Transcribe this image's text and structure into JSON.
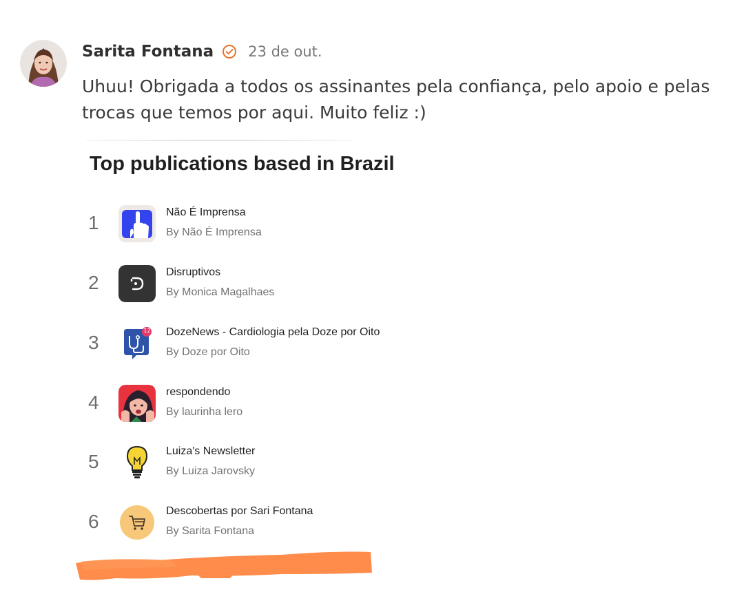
{
  "post": {
    "author": "Sarita Fontana",
    "date": "23 de out.",
    "text": "Uhuu! Obrigada a todos os assinantes pela confiança, pelo apoio e pelas trocas que temos por aqui. Muito feliz :)"
  },
  "card": {
    "title": "Top publications based in Brazil",
    "items": [
      {
        "rank": "1",
        "name": "Não É Imprensa",
        "author": "By Não É Imprensa",
        "logo": "pointing-hand-icon"
      },
      {
        "rank": "2",
        "name": "Disruptivos",
        "author": "By Monica Magalhaes",
        "logo": "d-letter-icon"
      },
      {
        "rank": "3",
        "name": "DozeNews - Cardiologia pela Doze por Oito",
        "author": "By Doze por Oito",
        "logo": "medical-chat-icon",
        "badge": "12"
      },
      {
        "rank": "4",
        "name": "respondendo",
        "author": "By laurinha lero",
        "logo": "illustrated-face-icon"
      },
      {
        "rank": "5",
        "name": "Luiza's Newsletter",
        "author": "By Luiza Jarovsky",
        "logo": "lightbulb-icon"
      },
      {
        "rank": "6",
        "name": "Descobertas por Sari Fontana",
        "author": "By Sarita Fontana",
        "logo": "shopping-cart-icon"
      }
    ]
  },
  "colors": {
    "verified": "#e8742a",
    "redaction": "#ff8c4b"
  }
}
